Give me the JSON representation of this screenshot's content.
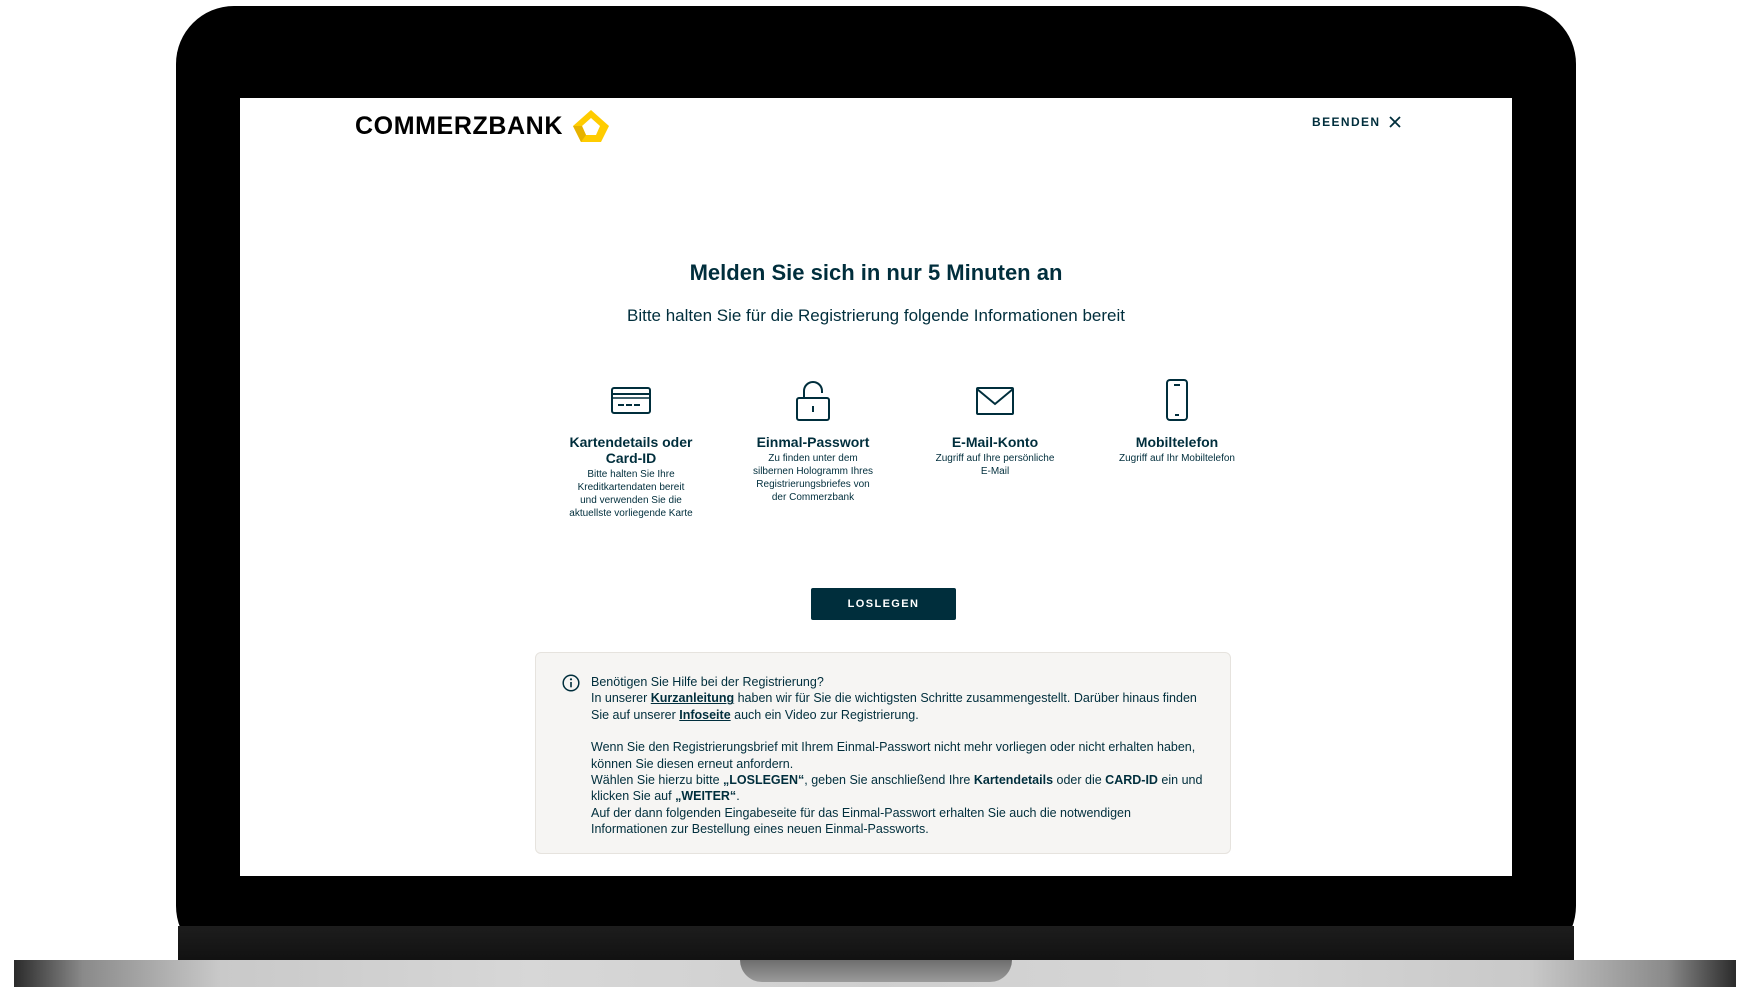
{
  "brand": {
    "name": "COMMERZBANK",
    "colors": {
      "primary": "#002e3c",
      "accent": "#ffcc00",
      "background": "#ffffff",
      "info_box": "#f6f5f3"
    }
  },
  "header": {
    "end_label": "BEENDEN",
    "close_icon": "close-icon"
  },
  "main": {
    "title": "Melden Sie sich in nur 5 Minuten an",
    "subtitle": "Bitte halten Sie für die Registrierung folgende Informationen bereit",
    "requirements": [
      {
        "icon": "credit-card-icon",
        "title": "Kartendetails oder Card-ID",
        "description": "Bitte halten Sie Ihre Kreditkartendaten bereit und verwenden Sie die aktuellste vorliegende Karte"
      },
      {
        "icon": "lock-icon",
        "title": "Einmal-Passwort",
        "description": "Zu finden unter dem silbernen Hologramm Ihres Registrierungsbriefes von der Commerzbank"
      },
      {
        "icon": "envelope-icon",
        "title": "E-Mail-Konto",
        "description": "Zugriff auf Ihre persönliche E-Mail"
      },
      {
        "icon": "smartphone-icon",
        "title": "Mobiltelefon",
        "description": "Zugriff auf Ihr Mobiltelefon"
      }
    ],
    "cta_label": "LOSLEGEN"
  },
  "help": {
    "icon": "info-icon",
    "question": "Benötigen Sie Hilfe bei der Registrierung?",
    "p1_a": "In unserer ",
    "p1_link1": "Kurzanleitung",
    "p1_b": " haben wir für Sie die wichtigsten Schritte zusammengestellt. Darüber hinaus finden Sie auf unserer ",
    "p1_link2": "Infoseite",
    "p1_c": " auch ein Video zur Registrierung.",
    "p2": "Wenn Sie den Registrierungsbrief mit Ihrem Einmal-Passwort nicht mehr vorliegen oder nicht erhalten haben, können Sie diesen erneut anfordern.",
    "p3_a": "Wählen Sie hierzu bitte ",
    "p3_b1": "„LOSLEGEN“",
    "p3_b": ", geben Sie anschließend Ihre ",
    "p3_b2": "Kartendetails",
    "p3_c": " oder die ",
    "p3_b3": "CARD-ID",
    "p3_d": " ein und klicken Sie auf ",
    "p3_b4": "„WEITER“",
    "p3_e": ".",
    "p4": "Auf der dann folgenden Eingabeseite für das Einmal-Passwort erhalten Sie auch die notwendigen Informationen zur Bestellung eines neuen Einmal-Passworts."
  }
}
